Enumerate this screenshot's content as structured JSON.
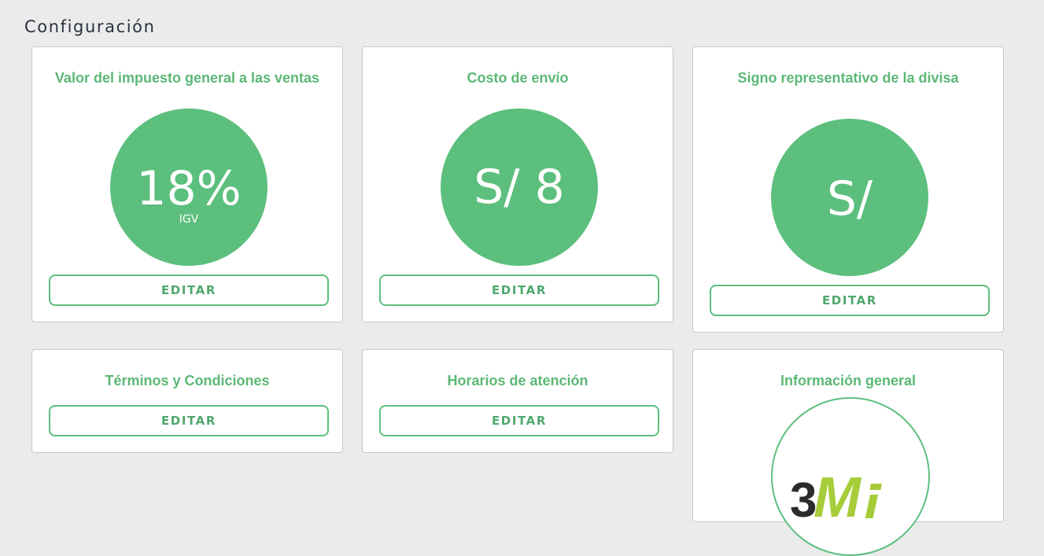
{
  "page": {
    "title": "Configuración"
  },
  "cards": {
    "igv": {
      "title": "Valor del impuesto general a las ventas",
      "value": "18%",
      "subvalue": "IGV",
      "button": "EDITAR"
    },
    "shipping": {
      "title": "Costo de envío",
      "value": "S/ 8",
      "button": "EDITAR"
    },
    "currency": {
      "title": "Signo representativo de la divisa",
      "value": "S/",
      "button": "EDITAR"
    },
    "terms": {
      "title": "Términos y Condiciones",
      "button": "EDITAR"
    },
    "hours": {
      "title": "Horarios de atención",
      "button": "EDITAR"
    },
    "info": {
      "title": "Información general",
      "logo_text": "3M"
    }
  },
  "colors": {
    "accent": "#5cbf7d",
    "title_green": "#5cb876",
    "logo_dark": "#2b2b2b",
    "logo_lime": "#a6cd39"
  }
}
